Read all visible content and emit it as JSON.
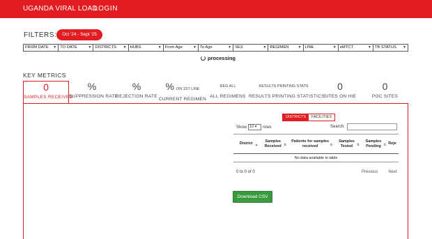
{
  "navbar": {
    "brand": "UGANDA VIRAL LOAD",
    "login": "LOGIN"
  },
  "filters": {
    "label": "FILTERS:",
    "date_range": "Oct '24 - Sept '25",
    "selects": [
      "FROM DATE",
      "TO DATE",
      "DISTRICTS",
      "HUBS",
      "From Age",
      "To Age",
      "SEX",
      "REGIMEN",
      "LINE",
      "eMTCT",
      "TB STATUS"
    ]
  },
  "processing": "processing",
  "key_metrics": {
    "title": "KEY METRICS",
    "items": [
      {
        "value": "0",
        "label": "SAMPLES RECEIVED"
      },
      {
        "value": "%",
        "label": "SUPPRESSION RATE"
      },
      {
        "value": "%",
        "label": "REJECTION RATE"
      },
      {
        "value": "%",
        "extra": "ON 1ST LINE",
        "label": "CURRENT REGIMEN"
      },
      {
        "value": "REG ALL",
        "label": "ALL REGIMENS"
      },
      {
        "value": "RESULTS PRINTING STATS",
        "label": "RESULTS PRINTING STATISTICS"
      },
      {
        "value": "0",
        "label": "SITES ON HIE"
      },
      {
        "value": "0",
        "label": "POC SITES"
      }
    ]
  },
  "table": {
    "toggle": {
      "districts": "DISTRICTS",
      "facilities": "FACILITIES"
    },
    "show_label": "Show",
    "show_value": "10",
    "rows_label": "rows",
    "search_label": "Search:",
    "columns": [
      "District",
      "Samples Received",
      "Patients for samples received",
      "Samples Tested",
      "Samples Pending",
      "Reje"
    ],
    "empty": "No data available in table",
    "info": "0 to 0 of 0",
    "previous": "Previous",
    "next": "Next"
  },
  "download_csv": "Download CSV",
  "colors": {
    "brand_red": "#e21d22",
    "csv_green": "#3a9b3e"
  },
  "icons": {
    "processing": "spinner-icon",
    "sort": "sort-arrows-icon",
    "dropdown": "chevron-down-icon"
  }
}
